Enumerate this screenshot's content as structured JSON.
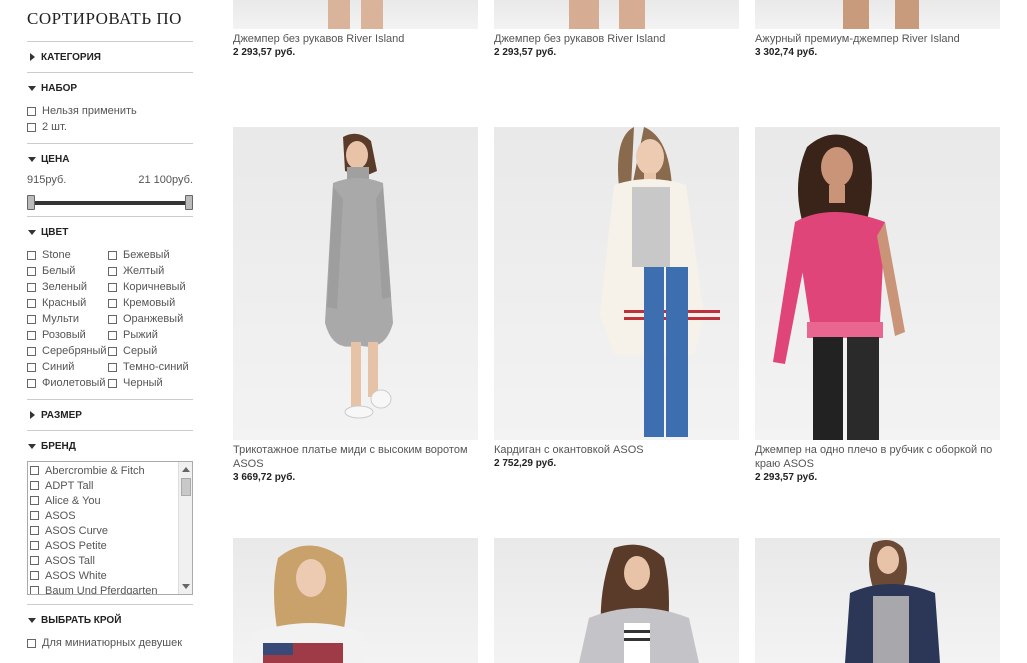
{
  "sidebar": {
    "sort_title": "СОРТИРОВАТЬ ПО",
    "category_label": "КАТЕГОРИЯ",
    "set": {
      "label": "НАБОР",
      "options": [
        "Нельзя применить",
        "2 шт."
      ]
    },
    "price": {
      "label": "ЦЕНА",
      "min": "915руб.",
      "max": "21 100руб."
    },
    "color": {
      "label": "ЦВЕТ",
      "left": [
        "Stone",
        "Белый",
        "Зеленый",
        "Красный",
        "Мульти",
        "Розовый",
        "Серебряный",
        "Синий",
        "Фиолетовый"
      ],
      "right": [
        "Бежевый",
        "Желтый",
        "Коричневый",
        "Кремовый",
        "Оранжевый",
        "Рыжий",
        "Серый",
        "Темно-синий",
        "Черный"
      ]
    },
    "size_label": "РАЗМЕР",
    "brand": {
      "label": "БРЕНД",
      "options": [
        "Abercrombie & Fitch",
        "ADPT Tall",
        "Alice & You",
        "ASOS",
        "ASOS Curve",
        "ASOS Petite",
        "ASOS Tall",
        "ASOS White",
        "Baum Und Pferdgarten"
      ]
    },
    "fit": {
      "label": "ВЫБРАТЬ КРОЙ",
      "options": [
        "Для миниатюрных девушек"
      ]
    }
  },
  "products": {
    "row1": [
      {
        "name": "Джемпер без рукавов River Island",
        "price": "2 293,57 руб."
      },
      {
        "name": "Джемпер без рукавов River Island",
        "price": "2 293,57 руб."
      },
      {
        "name": "Ажурный премиум-джемпер River Island",
        "price": "3 302,74 руб."
      }
    ],
    "row2": [
      {
        "name": "Трикотажное платье миди с высоким воротом ASOS",
        "price": "3 669,72 руб."
      },
      {
        "name": "Кардиган с окантовкой ASOS",
        "price": "2 752,29 руб."
      },
      {
        "name": "Джемпер на одно плечо в рубчик с оборкой по краю ASOS",
        "price": "2 293,57 руб."
      }
    ]
  },
  "colors": {
    "page_bg": "#ffffff",
    "photo_bg": "#efefef",
    "pink_top": "#e0457a",
    "jeans": "#3d6fb0",
    "dress": "#a9a9a9",
    "cardigan": "#f6f2ea",
    "navy": "#2c3657"
  }
}
